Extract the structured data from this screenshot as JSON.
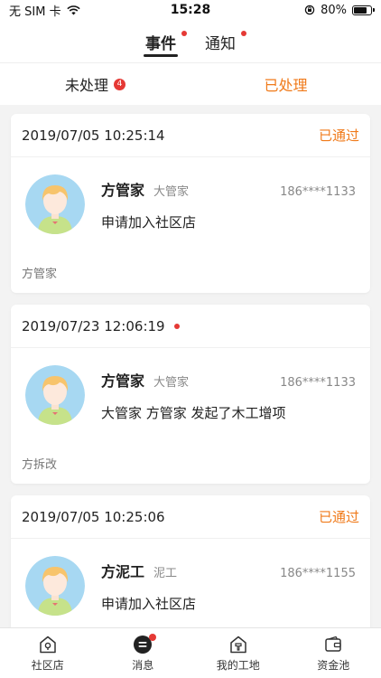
{
  "status_bar": {
    "carrier": "无 SIM 卡",
    "time": "15:28",
    "battery": "80%",
    "battery_level": 0.8
  },
  "top_tabs": [
    {
      "label": "事件",
      "active": true,
      "dot": true
    },
    {
      "label": "通知",
      "active": false,
      "dot": true
    }
  ],
  "sub_tabs": {
    "pending_label": "未处理",
    "pending_count": "4",
    "done_label": "已处理"
  },
  "cards": [
    {
      "time": "2019/07/05 10:25:14",
      "status": "已通过",
      "name": "方管家",
      "role": "大管家",
      "phone": "186****1133",
      "desc": "申请加入社区店",
      "footer": "方管家"
    },
    {
      "time": "2019/07/23 12:06:19",
      "status": "",
      "name": "方管家",
      "role": "大管家",
      "phone": "186****1133",
      "desc": "大管家 方管家 发起了木工增项",
      "footer": "方拆改"
    },
    {
      "time": "2019/07/05 10:25:06",
      "status": "已通过",
      "name": "方泥工",
      "role": "泥工",
      "phone": "186****1155",
      "desc": "申请加入社区店",
      "footer": ""
    }
  ],
  "bottom_nav": [
    {
      "label": "社区店",
      "icon": "store-icon"
    },
    {
      "label": "消息",
      "icon": "message-icon"
    },
    {
      "label": "我的工地",
      "icon": "worksite-icon"
    },
    {
      "label": "资金池",
      "icon": "wallet-icon"
    }
  ],
  "colors": {
    "accent": "#f07a1a",
    "alert": "#e53935"
  }
}
